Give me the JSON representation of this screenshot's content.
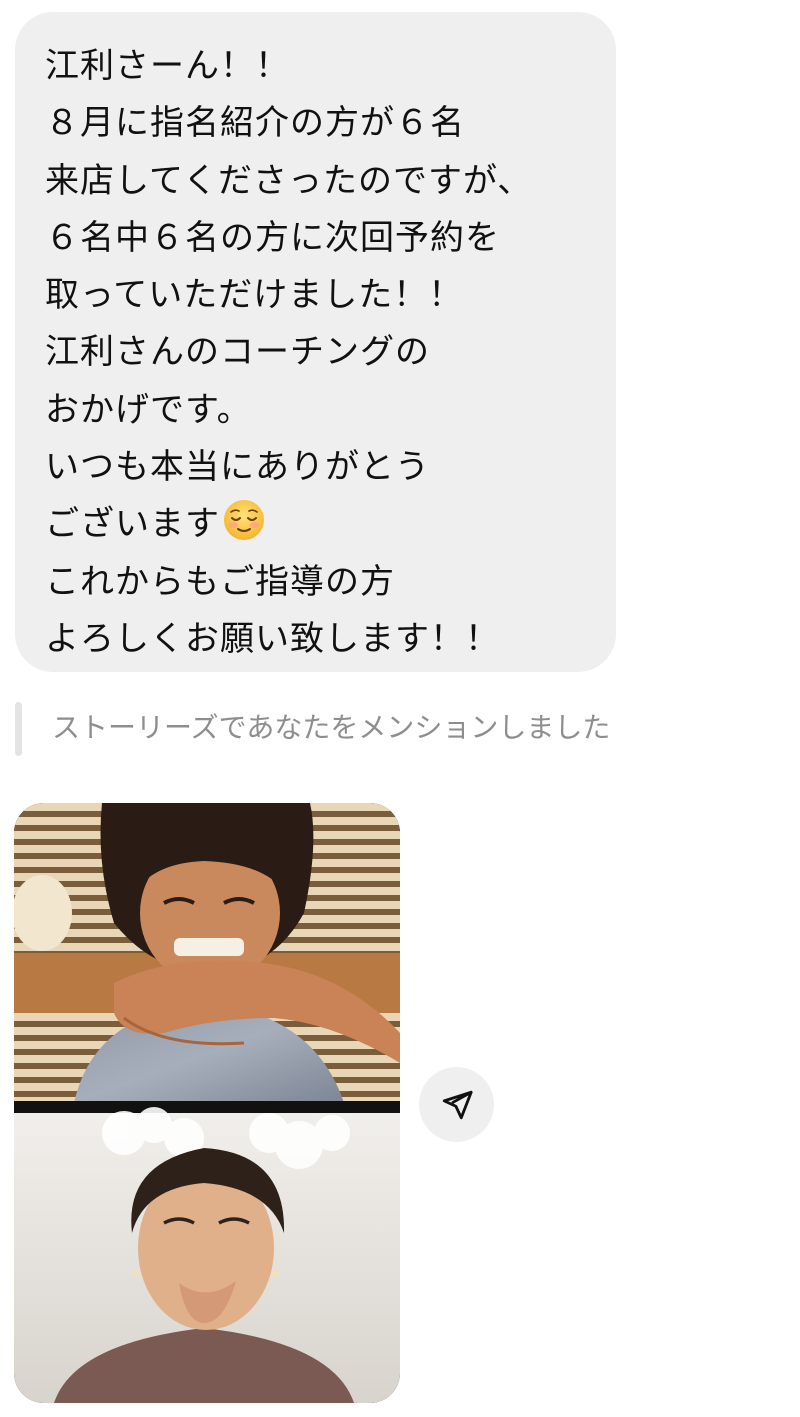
{
  "message": {
    "lines": [
      "江利さーん！！",
      "８月に指名紹介の方が６名",
      "来店してくださったのですが、",
      "６名中６名の方に次回予約を",
      "取っていただけました！！",
      "江利さんのコーチングの",
      "おかげです。",
      "いつも本当にありがとう",
      "ございます",
      "これからもご指導の方",
      "よろしくお願い致します！！"
    ],
    "emoji_icon": "relieved-face-icon"
  },
  "mention": {
    "text": "ストーリーズであなたをメンションしました"
  },
  "story": {
    "image_top": "video-call-man-laughing",
    "image_bottom": "video-call-woman-laughing"
  },
  "share": {
    "icon": "paper-plane-icon"
  },
  "colors": {
    "bubble_bg": "#efefef",
    "text": "#111111",
    "mention_text": "#8e8e8e"
  }
}
